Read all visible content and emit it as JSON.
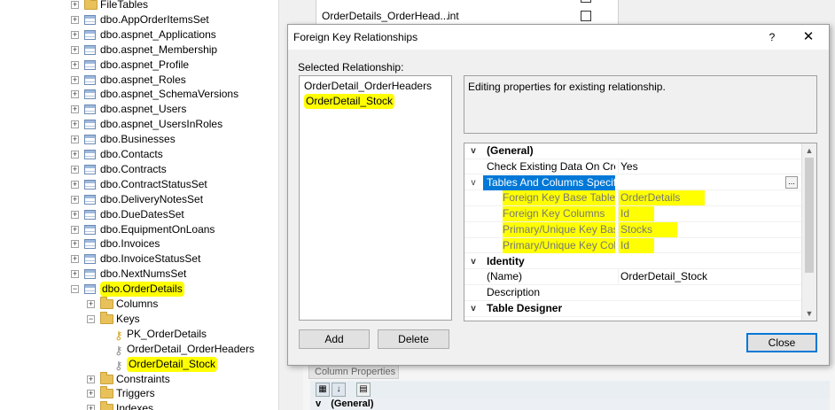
{
  "tree": {
    "items": [
      {
        "label": "FileTables",
        "icon": "folder-icon",
        "toggle": "+"
      },
      {
        "label": "dbo.AppOrderItemsSet",
        "icon": "table-icon",
        "toggle": "+"
      },
      {
        "label": "dbo.aspnet_Applications",
        "icon": "table-icon",
        "toggle": "+"
      },
      {
        "label": "dbo.aspnet_Membership",
        "icon": "table-icon",
        "toggle": "+"
      },
      {
        "label": "dbo.aspnet_Profile",
        "icon": "table-icon",
        "toggle": "+"
      },
      {
        "label": "dbo.aspnet_Roles",
        "icon": "table-icon",
        "toggle": "+"
      },
      {
        "label": "dbo.aspnet_SchemaVersions",
        "icon": "table-icon",
        "toggle": "+"
      },
      {
        "label": "dbo.aspnet_Users",
        "icon": "table-icon",
        "toggle": "+"
      },
      {
        "label": "dbo.aspnet_UsersInRoles",
        "icon": "table-icon",
        "toggle": "+"
      },
      {
        "label": "dbo.Businesses",
        "icon": "table-icon",
        "toggle": "+"
      },
      {
        "label": "dbo.Contacts",
        "icon": "table-icon",
        "toggle": "+"
      },
      {
        "label": "dbo.Contracts",
        "icon": "table-icon",
        "toggle": "+"
      },
      {
        "label": "dbo.ContractStatusSet",
        "icon": "table-icon",
        "toggle": "+"
      },
      {
        "label": "dbo.DeliveryNotesSet",
        "icon": "table-icon",
        "toggle": "+"
      },
      {
        "label": "dbo.DueDatesSet",
        "icon": "table-icon",
        "toggle": "+"
      },
      {
        "label": "dbo.EquipmentOnLoans",
        "icon": "table-icon",
        "toggle": "+"
      },
      {
        "label": "dbo.Invoices",
        "icon": "table-icon",
        "toggle": "+"
      },
      {
        "label": "dbo.InvoiceStatusSet",
        "icon": "table-icon",
        "toggle": "+"
      },
      {
        "label": "dbo.NextNumsSet",
        "icon": "table-icon",
        "toggle": "+"
      },
      {
        "label": "dbo.OrderDetails",
        "icon": "table-icon",
        "toggle": "−",
        "highlight": true
      },
      {
        "label": "Columns",
        "icon": "folder-icon",
        "toggle": "+",
        "indent": 1
      },
      {
        "label": "Keys",
        "icon": "folder-icon",
        "toggle": "−",
        "indent": 1
      },
      {
        "label": "PK_OrderDetails",
        "icon": "key-icon",
        "indent": 2,
        "key_color": "#d4a017"
      },
      {
        "label": "OrderDetail_OrderHeaders",
        "icon": "key-icon",
        "indent": 2,
        "key_color": "#8a8a8a"
      },
      {
        "label": "OrderDetail_Stock",
        "icon": "key-icon",
        "indent": 2,
        "key_color": "#8a8a8a",
        "highlight": true
      },
      {
        "label": "Constraints",
        "icon": "folder-icon",
        "toggle": "+",
        "indent": 1
      },
      {
        "label": "Triggers",
        "icon": "folder-icon",
        "toggle": "+",
        "indent": 1
      },
      {
        "label": "Indexes",
        "icon": "folder-icon",
        "toggle": "+",
        "indent": 1
      }
    ]
  },
  "background": {
    "row1_name": "",
    "row2_name": "OrderDetails_OrderHead...",
    "row2_type": "int",
    "tab_label": "Column Properties",
    "prop_header": "(General)"
  },
  "dialog": {
    "title": "Foreign Key Relationships",
    "help": "?",
    "close_x": "✕",
    "selected_label": "Selected Relationship:",
    "relationships": [
      {
        "label": "OrderDetail_OrderHeaders"
      },
      {
        "label": "OrderDetail_Stock",
        "highlight": true
      }
    ],
    "description": "Editing properties for existing relationship.",
    "add_label": "Add",
    "delete_label": "Delete",
    "close_label": "Close",
    "grid": [
      {
        "type": "category",
        "expand": "v",
        "name": "(General)"
      },
      {
        "type": "prop",
        "name": "Check Existing Data On Creat",
        "value": "Yes"
      },
      {
        "type": "selected",
        "expand": "v",
        "name": "Tables And Columns Specifica",
        "ellipsis": "..."
      },
      {
        "type": "sub",
        "name": "Foreign Key Base Table",
        "value": "OrderDetails",
        "highlight": true
      },
      {
        "type": "sub",
        "name": "Foreign Key Columns",
        "value": "Id",
        "highlight": true
      },
      {
        "type": "sub",
        "name": "Primary/Unique Key Base",
        "value": "Stocks",
        "highlight": true
      },
      {
        "type": "sub",
        "name": "Primary/Unique Key Colu",
        "value": "Id",
        "highlight": true
      },
      {
        "type": "category",
        "expand": "v",
        "name": "Identity"
      },
      {
        "type": "prop",
        "name": "(Name)",
        "value": "OrderDetail_Stock"
      },
      {
        "type": "prop",
        "name": "Description",
        "value": ""
      },
      {
        "type": "category",
        "expand": "v",
        "name": "Table Designer"
      }
    ],
    "scroll_up": "▲",
    "scroll_down": "▼"
  },
  "colors": {
    "highlight": "#ffff00",
    "selection": "#0078d7"
  }
}
